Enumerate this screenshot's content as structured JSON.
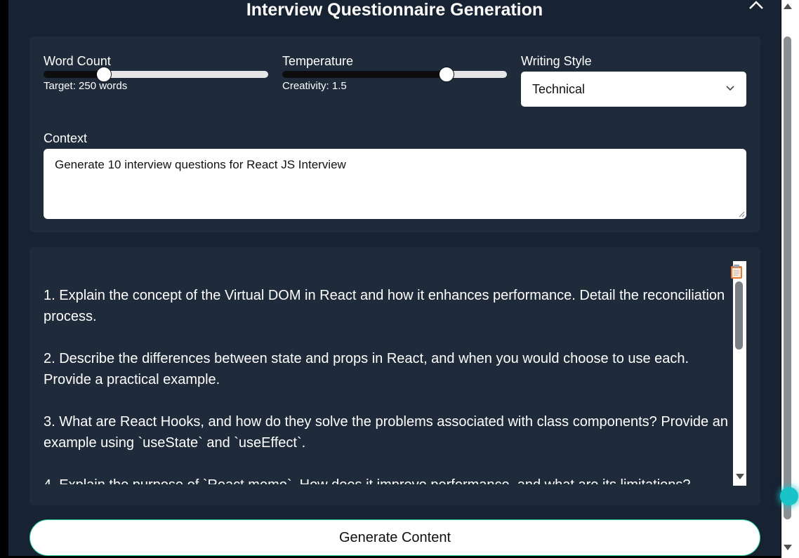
{
  "header": {
    "title": "Interview Questionnaire Generation",
    "close_icon": "close-icon"
  },
  "settings": {
    "word_count": {
      "label": "Word Count",
      "caption": "Target: 250 words",
      "value_fraction": 0.27
    },
    "temperature": {
      "label": "Temperature",
      "caption": "Creativity: 1.5",
      "value_fraction": 0.73
    },
    "writing_style": {
      "label": "Writing Style",
      "selected": "Technical"
    },
    "context": {
      "label": "Context",
      "value": "Generate 10 interview questions for React JS Interview"
    }
  },
  "output": {
    "items": [
      "1.  Explain the concept of the Virtual DOM in React and how it enhances performance. Detail the reconciliation process.",
      "2.  Describe the differences between state and props in React, and when you would choose to use each. Provide a practical example.",
      "3.  What are React Hooks, and how do they solve the problems associated with class components? Provide an example using `useState` and `useEffect`.",
      "4.  Explain the purpose of `React.memo`. How does it improve performance, and what are its limitations?"
    ],
    "copy_icon": "clipboard-icon"
  },
  "actions": {
    "generate_label": "Generate Content"
  },
  "colors": {
    "background": "#172232",
    "panel": "#1f2b3b",
    "slider_track_filled": "#0d0d0d",
    "slider_track_empty": "#e6e6e6",
    "button_border": "#2dd4a0",
    "accent_handle": "#19c3c8"
  }
}
